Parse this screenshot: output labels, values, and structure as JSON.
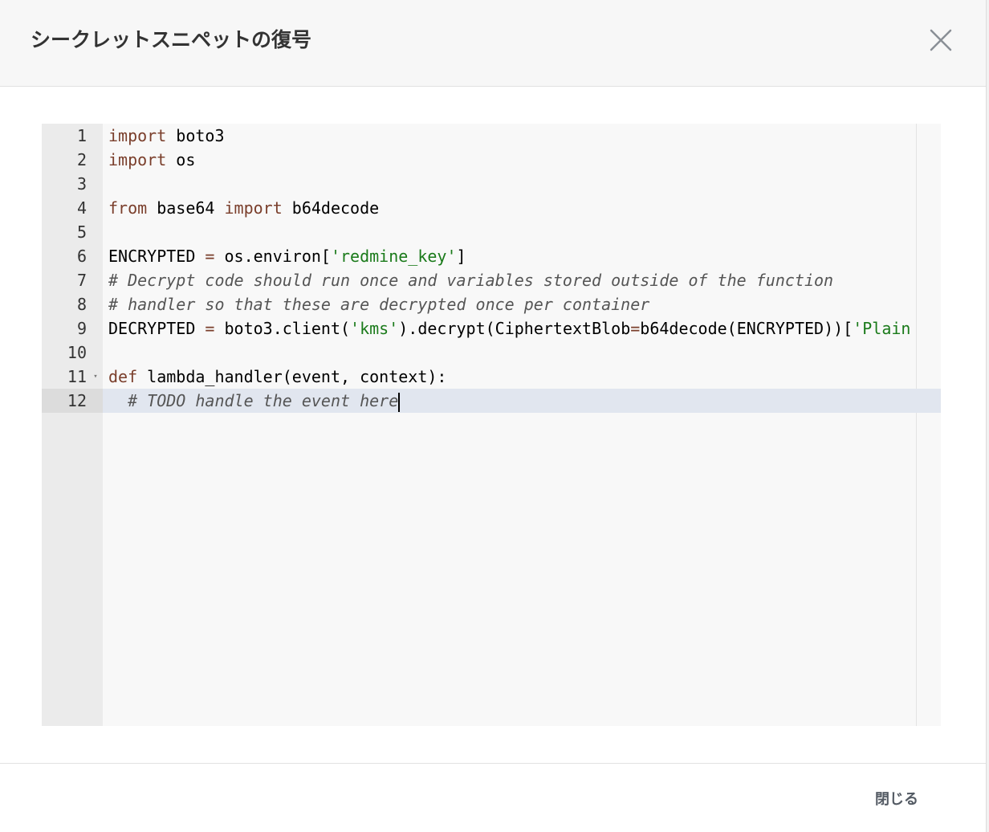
{
  "modal": {
    "title": "シークレットスニペットの復号",
    "close_icon": "close-x-icon",
    "close_button_label": "閉じる"
  },
  "editor": {
    "active_line": 12,
    "lines": [
      {
        "num": "1",
        "tokens": [
          {
            "t": "kw",
            "v": "import"
          },
          {
            "t": "tx",
            "v": " boto3"
          }
        ]
      },
      {
        "num": "2",
        "tokens": [
          {
            "t": "kw",
            "v": "import"
          },
          {
            "t": "tx",
            "v": " os"
          }
        ]
      },
      {
        "num": "3",
        "tokens": []
      },
      {
        "num": "4",
        "tokens": [
          {
            "t": "kw",
            "v": "from"
          },
          {
            "t": "tx",
            "v": " base64 "
          },
          {
            "t": "kw",
            "v": "import"
          },
          {
            "t": "tx",
            "v": " b64decode"
          }
        ]
      },
      {
        "num": "5",
        "tokens": []
      },
      {
        "num": "6",
        "tokens": [
          {
            "t": "tx",
            "v": "ENCRYPTED "
          },
          {
            "t": "kw",
            "v": "="
          },
          {
            "t": "tx",
            "v": " os.environ["
          },
          {
            "t": "str",
            "v": "'redmine_key'"
          },
          {
            "t": "tx",
            "v": "]"
          }
        ]
      },
      {
        "num": "7",
        "tokens": [
          {
            "t": "cm",
            "v": "# Decrypt code should run once and variables stored outside of the function"
          }
        ]
      },
      {
        "num": "8",
        "tokens": [
          {
            "t": "cm",
            "v": "# handler so that these are decrypted once per container"
          }
        ]
      },
      {
        "num": "9",
        "tokens": [
          {
            "t": "tx",
            "v": "DECRYPTED "
          },
          {
            "t": "kw",
            "v": "="
          },
          {
            "t": "tx",
            "v": " boto3.client("
          },
          {
            "t": "str",
            "v": "'kms'"
          },
          {
            "t": "tx",
            "v": ").decrypt(CiphertextBlob"
          },
          {
            "t": "kw",
            "v": "="
          },
          {
            "t": "tx",
            "v": "b64decode(ENCRYPTED))["
          },
          {
            "t": "str",
            "v": "'Plain"
          }
        ]
      },
      {
        "num": "10",
        "tokens": []
      },
      {
        "num": "11",
        "fold": true,
        "tokens": [
          {
            "t": "kw",
            "v": "def"
          },
          {
            "t": "tx",
            "v": " lambda_handler(event, context):"
          }
        ]
      },
      {
        "num": "12",
        "tokens": [
          {
            "t": "tx",
            "v": "  "
          },
          {
            "t": "cm",
            "v": "# TODO handle the event here"
          }
        ],
        "cursor": true
      }
    ]
  },
  "colors": {
    "keyword": "#7a3e2b",
    "string": "#1a7a1a",
    "comment": "#555555",
    "active_line_bg": "#e1e6ef",
    "gutter_bg": "#ebebeb"
  }
}
